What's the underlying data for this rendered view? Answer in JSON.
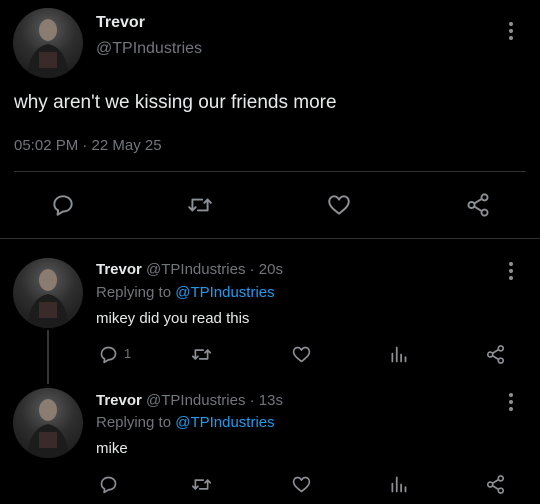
{
  "main_tweet": {
    "display_name": "Trevor",
    "handle": "@TPIndustries",
    "text": "why aren't we kissing our friends more",
    "timestamp": "05:02 PM · 22 May 25",
    "actions": [
      "reply-icon",
      "retweet-icon",
      "like-icon",
      "share-icon"
    ]
  },
  "replies": [
    {
      "display_name": "Trevor",
      "handle": "@TPIndustries",
      "age": "· 20s",
      "replying_prefix": "Replying to",
      "replying_handle": "@TPIndustries",
      "text": "mikey did you read this",
      "reply_count": "1"
    },
    {
      "display_name": "Trevor",
      "handle": "@TPIndustries",
      "age": "· 13s",
      "replying_prefix": "Replying to",
      "replying_handle": "@TPIndustries",
      "text": "mike",
      "reply_count": ""
    }
  ],
  "colors": {
    "background": "#000000",
    "text": "#e7e9ea",
    "muted": "#71767b",
    "link": "#1d9bf0",
    "divider": "#2f3336"
  }
}
